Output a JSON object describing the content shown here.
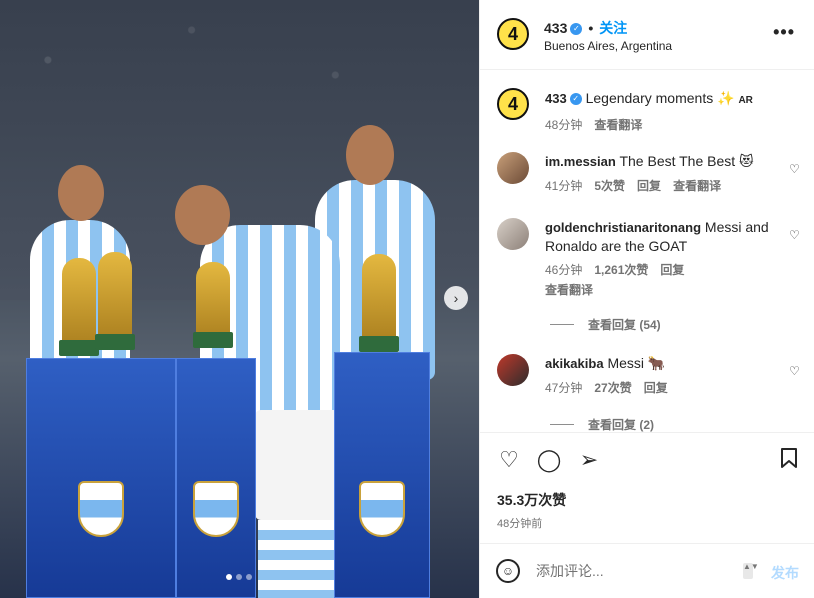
{
  "post": {
    "account": "433",
    "follow_label": "关注",
    "separator": "•",
    "location": "Buenos Aires, Argentina",
    "more_icon": "more-horizontal-icon",
    "avatar_text": "4"
  },
  "photo": {
    "next_icon": "chevron-right-icon",
    "next_glyph": "›",
    "slides": 3,
    "active_slide": 1
  },
  "caption": {
    "user": "433",
    "text": "Legendary moments ✨",
    "badge": "AR",
    "time": "48分钟",
    "translate": "查看翻译"
  },
  "comments": [
    {
      "user": "im.messian",
      "text": "The Best The Best 😻",
      "time": "41分钟",
      "likes": "5次赞",
      "reply": "回复",
      "translate": "查看翻译"
    },
    {
      "user": "goldenchristianaritonang",
      "text": "Messi and Ronaldo are the GOAT",
      "time": "46分钟",
      "likes": "1,261次赞",
      "reply": "回复",
      "translate": "查看翻译",
      "view_replies": "查看回复 (54)"
    },
    {
      "user": "akikakiba",
      "text": "Messi 🐂",
      "time": "47分钟",
      "likes": "27次赞",
      "reply": "回复",
      "view_replies": "查看回复 (2)"
    }
  ],
  "actions": {
    "like_icon": "heart-icon",
    "comment_icon": "comment-icon",
    "share_icon": "send-icon",
    "save_icon": "bookmark-icon",
    "likes": "35.3万次赞",
    "posted": "48分钟前"
  },
  "add_comment": {
    "placeholder": "添加评论...",
    "post_label": "发布",
    "emoji_icon": "emoji-icon"
  },
  "colors": {
    "link_blue": "#0095f6",
    "post_disabled": "#b3dbff",
    "brand_yellow": "#ffe24a"
  }
}
